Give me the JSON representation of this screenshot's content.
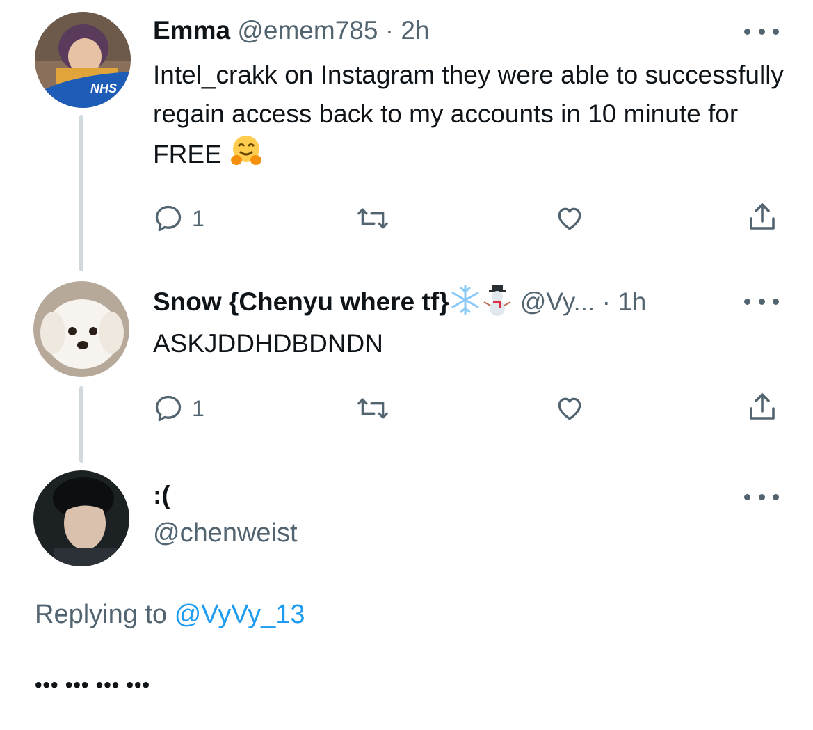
{
  "tweets": [
    {
      "name": "Emma",
      "handle": "@emem785",
      "time": "· 2h",
      "text": "Intel_crakk on Instagram they were able to successfully regain access back to my accounts in 10 minute for FREE",
      "text_emoji_icon": "hugging-face-emoji",
      "avatar_badge": "NHS",
      "reply_count": "1"
    },
    {
      "name": "Snow {Chenyu where tf}",
      "name_emoji_icons": [
        "snowflake-emoji",
        "snowman-emoji"
      ],
      "handle": "@Vy...",
      "time": "· 1h",
      "text": "ASKJDDHDBDNDN",
      "reply_count": "1"
    },
    {
      "name": ":(",
      "handle": "@chenweist"
    }
  ],
  "reply": {
    "prefix": "Replying to",
    "target": "@VyVy_13"
  },
  "compose_text": "••• ••• ••• •••",
  "colors": {
    "text": "#0f1419",
    "secondary": "#536471",
    "link": "#1d9bf0",
    "thread_line": "#cfd9de",
    "nhs_blue": "#1d5cb7",
    "emoji_yellow": "#ffcc4d"
  }
}
